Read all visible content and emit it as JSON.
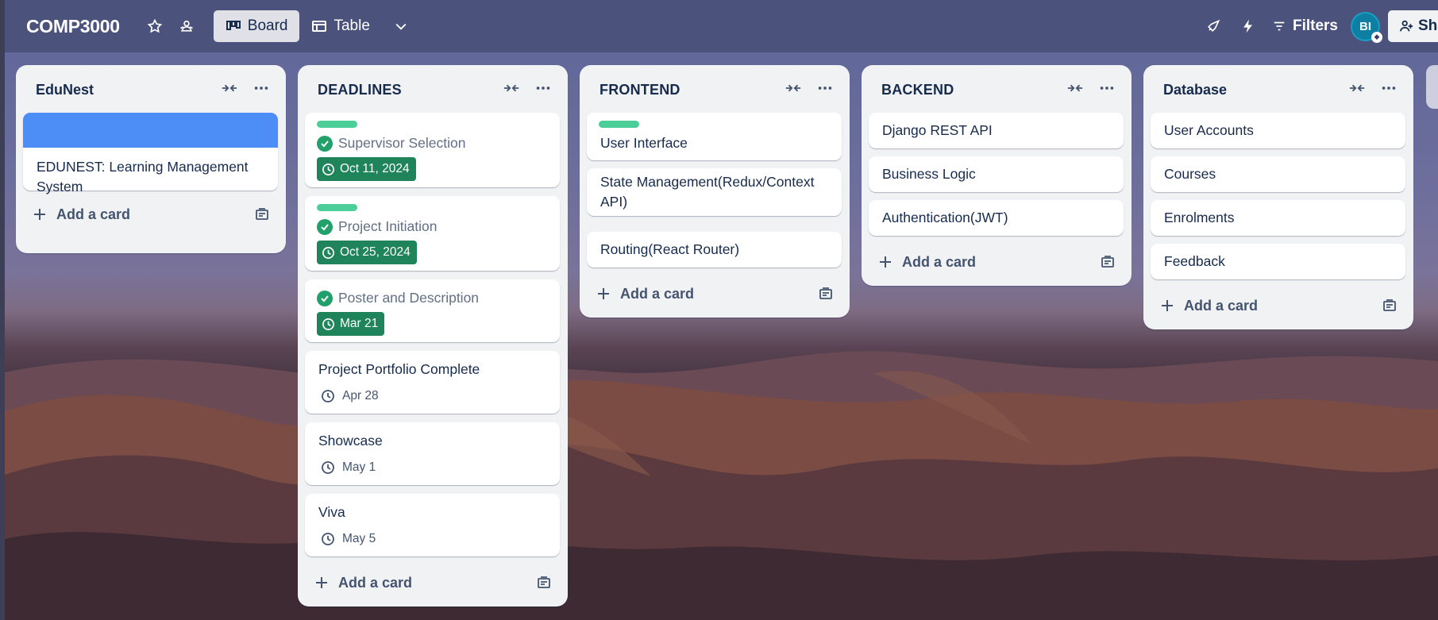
{
  "topbar": {
    "board_title": "COMP3000",
    "views": [
      {
        "label": "Board",
        "active": true
      },
      {
        "label": "Table",
        "active": false
      }
    ],
    "filters_label": "Filters",
    "avatar_initials": "BI",
    "share_label": "Share"
  },
  "lists": [
    {
      "title": "EduNest",
      "cards": [
        {
          "text": "EDUNEST: Learning Management System",
          "cover_color": "#4c8df6"
        }
      ],
      "add_card": "Add a card"
    },
    {
      "title": "DEADLINES",
      "cards": [
        {
          "text": "Supervisor Selection",
          "label_color": "#4bce97",
          "completed": true,
          "due": "Oct 11, 2024",
          "due_complete": true
        },
        {
          "text": "Project Initiation",
          "label_color": "#4bce97",
          "completed": true,
          "due": "Oct 25, 2024",
          "due_complete": true
        },
        {
          "text": "Poster and Description",
          "completed": true,
          "due": "Mar 21",
          "due_complete": true
        },
        {
          "text": "Project Portfolio Complete",
          "due": "Apr 28"
        },
        {
          "text": "Showcase",
          "due": "May 1"
        },
        {
          "text": "Viva",
          "due": "May 5"
        }
      ],
      "add_card": "Add a card"
    },
    {
      "title": "FRONTEND",
      "cards": [
        {
          "text": "User Interface",
          "label_color": "#4bce97"
        },
        {
          "text": "State Management(Redux/Context API)"
        },
        {
          "text": "Routing(React Router)"
        }
      ],
      "add_card": "Add a card"
    },
    {
      "title": "BACKEND",
      "cards": [
        {
          "text": "Django REST API"
        },
        {
          "text": "Business Logic"
        },
        {
          "text": "Authentication(JWT)"
        }
      ],
      "add_card": "Add a card"
    },
    {
      "title": "Database",
      "cards": [
        {
          "text": "User Accounts"
        },
        {
          "text": "Courses"
        },
        {
          "text": "Enrolments"
        },
        {
          "text": "Feedback"
        }
      ],
      "add_card": "Add a card"
    }
  ],
  "colors": {
    "topbar": "#4a5078",
    "list_bg": "#f1f2f4",
    "due_complete": "#1f845a",
    "check": "#22a06b",
    "label_green": "#4bce97",
    "cover_blue": "#4c8df6"
  }
}
